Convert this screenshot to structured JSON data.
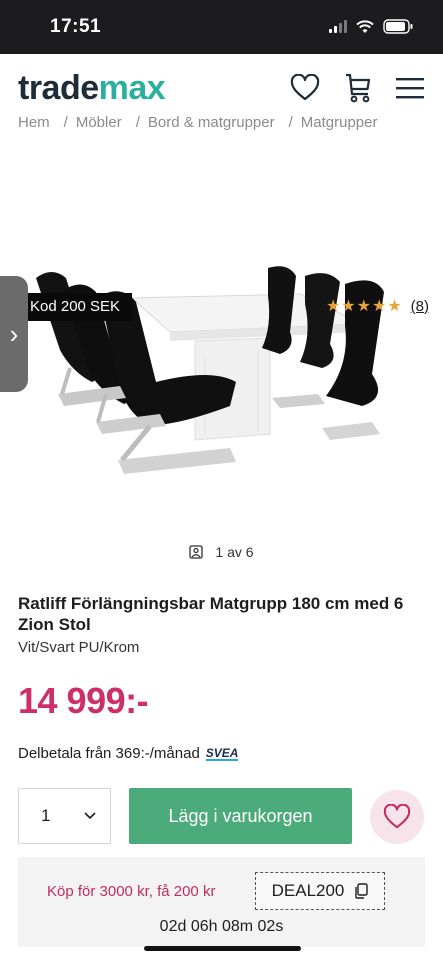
{
  "status_bar": {
    "time": "17:51",
    "icons": [
      "cellular-signal-icon",
      "wifi-icon",
      "battery-icon"
    ]
  },
  "header": {
    "logo_part1": "trade",
    "logo_part2": "max",
    "icons": [
      "heart-icon",
      "cart-icon",
      "menu-icon"
    ],
    "colors": {
      "logo_dark": "#1e2b3a",
      "logo_accent": "#2bb0a0"
    }
  },
  "breadcrumb": [
    "Hem",
    "Möbler",
    "Bord & matgrupper",
    "Matgrupper"
  ],
  "gallery": {
    "badge": "Kod 200 SEK",
    "rating_stars": 4.5,
    "review_count": "(8)",
    "counter": "1 av 6",
    "prev_arrow": "›"
  },
  "product": {
    "title": "Ratliff Förlängningsbar Matgrupp 180 cm med 6 Zion Stol",
    "variant": "Vit/Svart PU/Krom",
    "price": "14 999:-",
    "installment": "Delbetala från 369:-/månad",
    "installment_provider": "SVEA",
    "price_color": "#cc2f6a"
  },
  "purchase": {
    "quantity": "1",
    "add_to_cart": "Lägg i varukorgen",
    "button_color": "#4bab7a"
  },
  "promo": {
    "text": "Köp för 3000 kr, få 200 kr",
    "code": "DEAL200",
    "countdown": "02d 06h 08m 02s"
  }
}
